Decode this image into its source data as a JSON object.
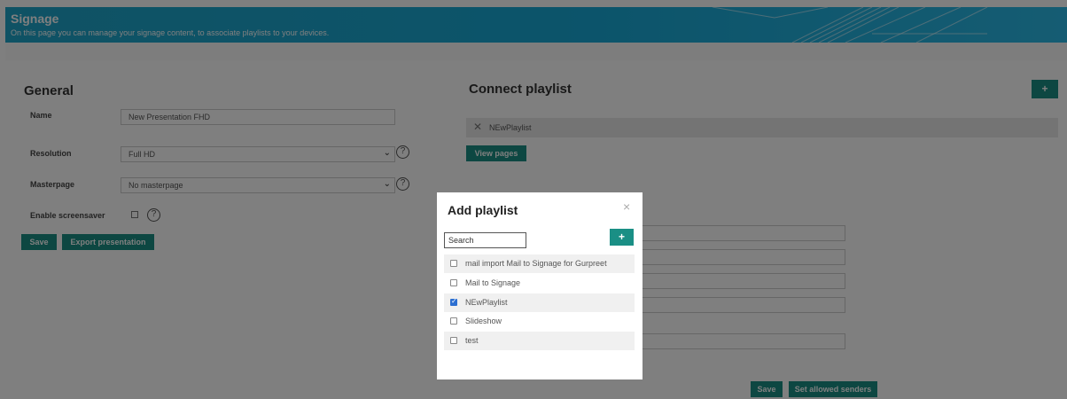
{
  "header": {
    "title": "Signage",
    "subtitle": "On this page you can manage your signage content, to associate playlists to your devices."
  },
  "general": {
    "heading": "General",
    "name_label": "Name",
    "name_value": "New Presentation FHD",
    "resolution_label": "Resolution",
    "resolution_value": "Full HD",
    "masterpage_label": "Masterpage",
    "masterpage_value": "No masterpage",
    "screensaver_label": "Enable screensaver",
    "help_glyph": "?",
    "save_label": "Save",
    "export_label": "Export presentation"
  },
  "connect": {
    "heading": "Connect playlist",
    "add_label": "+",
    "playlist_name": "NEwPlaylist",
    "view_pages_label": "View pages",
    "save_label": "Save",
    "senders_label": "Set allowed senders"
  },
  "modal": {
    "title": "Add playlist",
    "close_glyph": "×",
    "search_placeholder": "Search",
    "add_label": "+",
    "items": [
      {
        "label": "mail import Mail to Signage for Gurpreet",
        "checked": false
      },
      {
        "label": "Mail to Signage",
        "checked": false
      },
      {
        "label": "NEwPlaylist",
        "checked": true
      },
      {
        "label": "Slideshow",
        "checked": false
      },
      {
        "label": "test",
        "checked": false
      }
    ]
  },
  "colors": {
    "accent": "#1a8f85",
    "banner": "#1fa5c9",
    "checkbox_checked": "#2c6fd1"
  }
}
